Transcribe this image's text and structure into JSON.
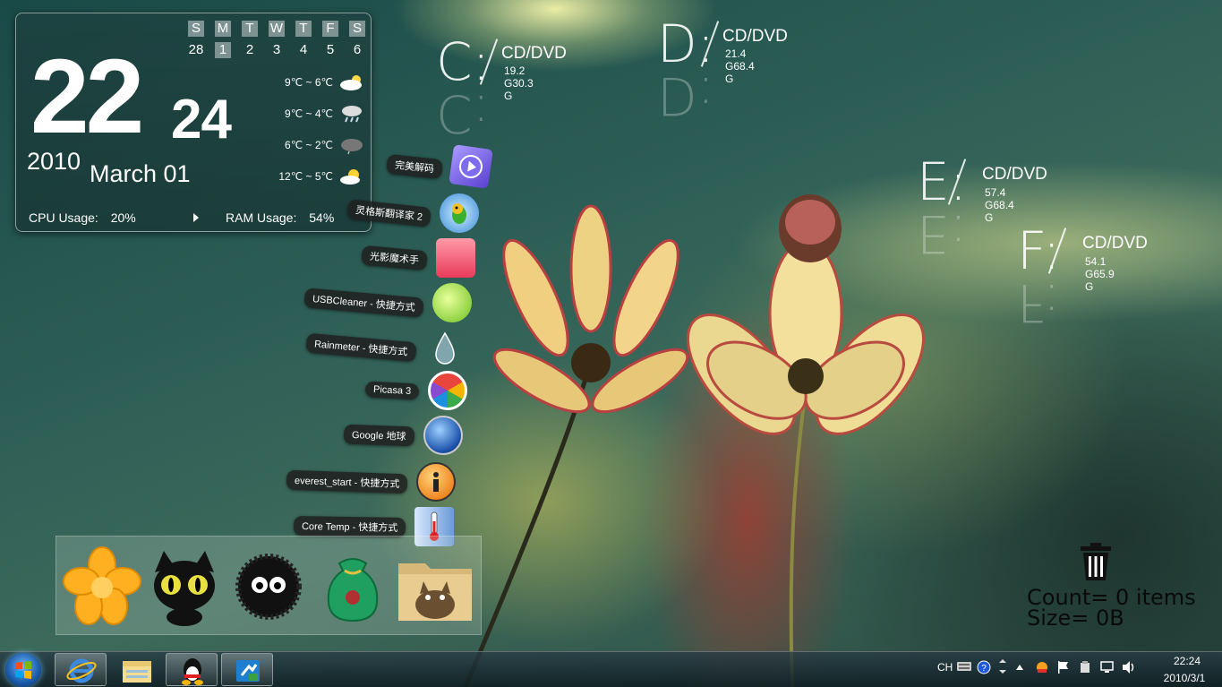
{
  "clock": {
    "hour": "22",
    "minute": "24",
    "year": "2010",
    "date": "March 01",
    "calendar": {
      "headers": [
        "S",
        "M",
        "T",
        "W",
        "T",
        "F",
        "S"
      ],
      "days": [
        "28",
        "1",
        "2",
        "3",
        "4",
        "5",
        "6"
      ],
      "today_index": 1
    },
    "weather": [
      {
        "temp": "9℃ ~ 6℃",
        "icon": "partly-cloudy-icon"
      },
      {
        "temp": "9℃ ~ 4℃",
        "icon": "rain-icon"
      },
      {
        "temp": "6℃ ~ 2℃",
        "icon": "cloudy-icon"
      },
      {
        "temp": "12℃ ~ 5℃",
        "icon": "sun-cloud-icon"
      }
    ],
    "cpu_label": "CPU Usage:",
    "cpu_value": "20%",
    "ram_label": "RAM Usage:",
    "ram_value": "54%"
  },
  "drives": [
    {
      "letter": "C:",
      "type": "CD/DVD",
      "used": "19.2 G",
      "total": "30.3 G"
    },
    {
      "letter": "D:",
      "type": "CD/DVD",
      "used": "21.4 G",
      "total": "68.4 G"
    },
    {
      "letter": "E:",
      "type": "CD/DVD",
      "used": "57.4 G",
      "total": "68.4 G"
    },
    {
      "letter": "F:",
      "type": "CD/DVD",
      "used": "54.1 G",
      "total": "65.9 G"
    }
  ],
  "stack": [
    {
      "label": "完美解码",
      "icon": "media-player-icon"
    },
    {
      "label": "灵格斯翻译家 2",
      "icon": "parrot-icon"
    },
    {
      "label": "光影魔术手",
      "icon": "photo-editor-icon"
    },
    {
      "label": "USBCleaner - 快捷方式",
      "icon": "usb-cleaner-icon"
    },
    {
      "label": "Rainmeter - 快捷方式",
      "icon": "water-drop-icon"
    },
    {
      "label": "Picasa 3",
      "icon": "picasa-icon"
    },
    {
      "label": "Google 地球",
      "icon": "globe-icon"
    },
    {
      "label": "everest_start - 快捷方式",
      "icon": "info-icon"
    },
    {
      "label": "Core Temp - 快捷方式",
      "icon": "thermometer-icon"
    }
  ],
  "dock": [
    {
      "icon": "flower-icon"
    },
    {
      "icon": "black-cat-icon"
    },
    {
      "icon": "soot-sprite-icon"
    },
    {
      "icon": "money-bag-icon"
    },
    {
      "icon": "totoro-folder-icon"
    }
  ],
  "recycle_bin": {
    "count": "Count= 0 items",
    "size": "Size= 0B"
  },
  "taskbar": {
    "apps": [
      "internet-explorer-icon",
      "file-explorer-icon",
      "qq-icon",
      "task-switch-icon"
    ],
    "lang": "CH",
    "time": "22:24",
    "date": "2010/3/1"
  }
}
